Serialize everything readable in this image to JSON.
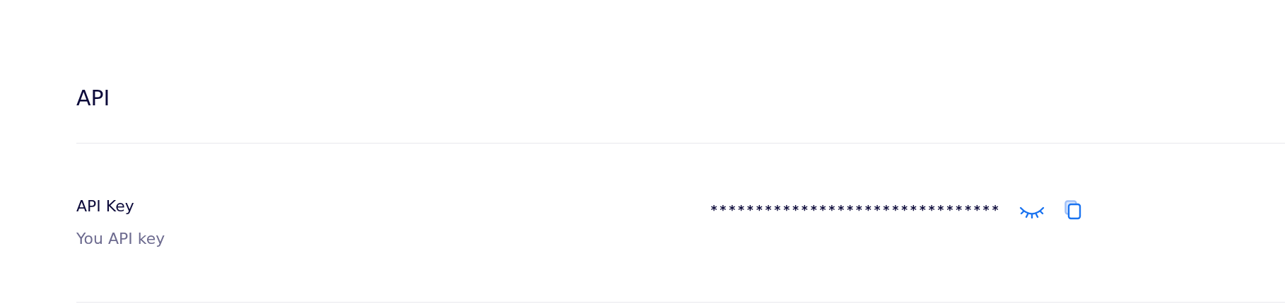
{
  "section": {
    "title": "API"
  },
  "rows": [
    {
      "label": "API Key",
      "description": "You API key",
      "value": "********************************"
    }
  ]
}
